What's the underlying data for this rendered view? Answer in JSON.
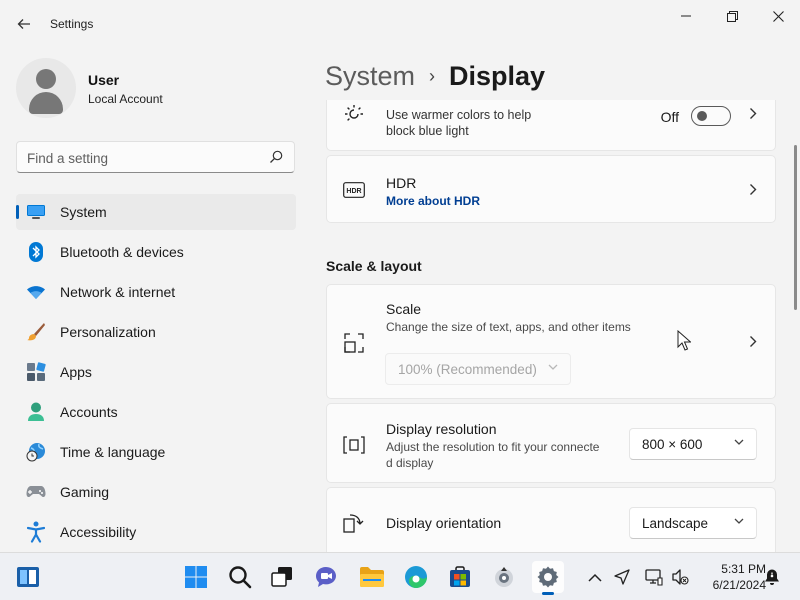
{
  "app": {
    "title": "Settings"
  },
  "user": {
    "name": "User",
    "account_type": "Local Account"
  },
  "search": {
    "placeholder": "Find a setting"
  },
  "sidebar": {
    "items": [
      {
        "label": "System",
        "icon": "monitor-icon",
        "active": true
      },
      {
        "label": "Bluetooth & devices",
        "icon": "bluetooth-icon"
      },
      {
        "label": "Network & internet",
        "icon": "wifi-icon"
      },
      {
        "label": "Personalization",
        "icon": "paintbrush-icon"
      },
      {
        "label": "Apps",
        "icon": "apps-icon"
      },
      {
        "label": "Accounts",
        "icon": "person-icon"
      },
      {
        "label": "Time & language",
        "icon": "globe-clock-icon"
      },
      {
        "label": "Gaming",
        "icon": "gamepad-icon"
      },
      {
        "label": "Accessibility",
        "icon": "accessibility-icon"
      }
    ]
  },
  "breadcrumb": {
    "parent": "System",
    "separator": "›",
    "current": "Display"
  },
  "night_light": {
    "subtitle_line1": "Use warmer colors to help",
    "subtitle_line2": "block blue light",
    "state": "Off"
  },
  "hdr": {
    "title": "HDR",
    "link": "More about HDR"
  },
  "section_scale_layout": "Scale & layout",
  "scale": {
    "title": "Scale",
    "subtitle": "Change the size of text, apps, and other items",
    "value": "100% (Recommended)"
  },
  "resolution": {
    "title": "Display resolution",
    "subtitle_line1": "Adjust the resolution to fit your connecte",
    "subtitle_line2": "d display",
    "value": "800 × 600"
  },
  "orientation": {
    "title": "Display orientation",
    "value": "Landscape"
  },
  "taskbar": {
    "apps": [
      "widgets-icon",
      "start-icon",
      "search-icon",
      "task-view-icon",
      "chat-icon",
      "file-explorer-icon",
      "edge-icon",
      "store-icon",
      "media-app-icon",
      "settings-icon"
    ],
    "time": "5:31 PM",
    "date": "6/21/2024"
  },
  "colors": {
    "accent": "#005fb8",
    "link": "#003e92"
  }
}
